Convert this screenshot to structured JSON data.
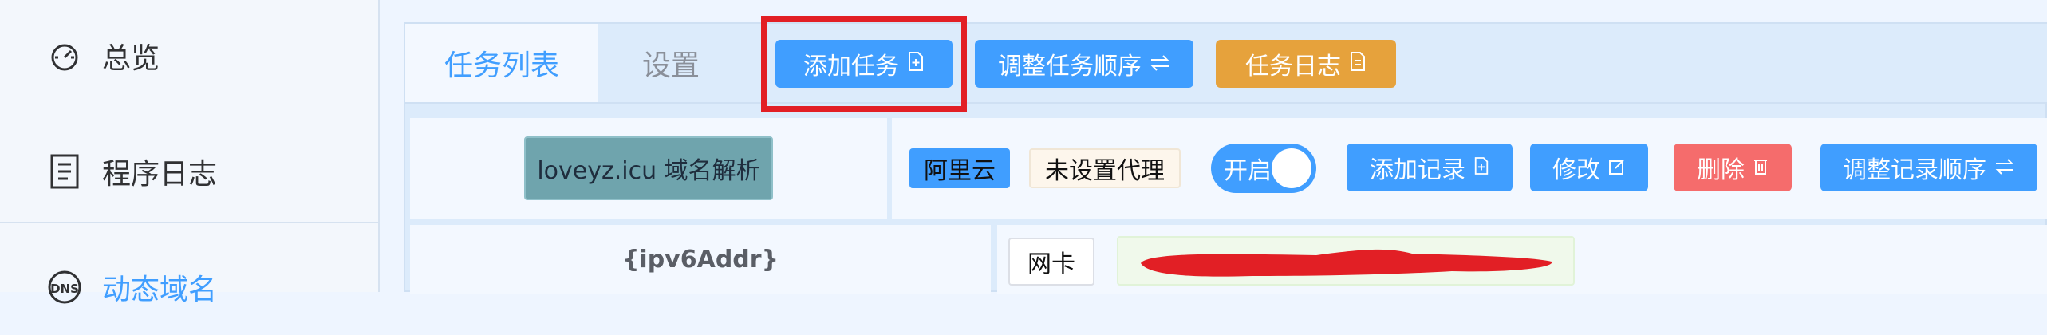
{
  "sidebar": {
    "items": [
      {
        "label": "总览",
        "icon": "dashboard-icon"
      },
      {
        "label": "程序日志",
        "icon": "log-document-icon"
      },
      {
        "label": "动态域名",
        "icon": "dns-icon"
      }
    ]
  },
  "tabs": [
    {
      "label": "任务列表",
      "active": true
    },
    {
      "label": "设置",
      "active": false
    }
  ],
  "toolbar": {
    "add_task": "添加任务",
    "reorder_tasks": "调整任务顺序",
    "task_log": "任务日志"
  },
  "task": {
    "name": "loveyz.icu 域名解析",
    "provider": "阿里云",
    "proxy": "未设置代理",
    "switch_label": "开启",
    "actions": {
      "add_record": "添加记录",
      "edit": "修改",
      "delete": "删除",
      "reorder_records": "调整记录顺序"
    }
  },
  "record": {
    "variable": "{ipv6Addr}",
    "source": "网卡"
  },
  "colors": {
    "primary": "#409eff",
    "warning": "#e6a23c",
    "danger": "#f56c6c",
    "highlight": "#e21f25",
    "redaction": "#e21f25"
  }
}
